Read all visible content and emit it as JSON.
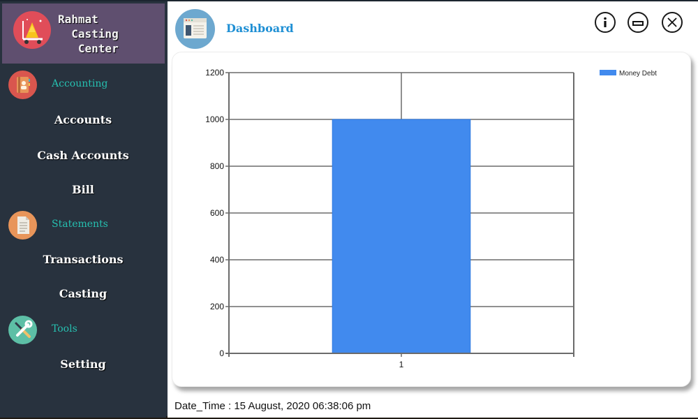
{
  "app": {
    "brand_name": "Rahmat\n  Casting\n   Center",
    "brand_logo_icon": "gold-cart-icon"
  },
  "sidebar": {
    "sections": [
      {
        "label": "Accounting",
        "icon": "address-book-icon",
        "icon_color": "#d9564e",
        "items": [
          "Accounts",
          "Cash Accounts",
          "Bill"
        ]
      },
      {
        "label": "Statements",
        "icon": "document-icon",
        "icon_color": "#e8955a",
        "items": [
          "Transactions",
          "Casting"
        ]
      },
      {
        "label": "Tools",
        "icon": "tools-icon",
        "icon_color": "#5dbfa6",
        "items": [
          "Setting"
        ]
      }
    ]
  },
  "header": {
    "title": "Dashboard",
    "page_icon": "browser-window-icon",
    "buttons": [
      {
        "name": "info",
        "icon": "info-icon"
      },
      {
        "name": "minimize",
        "icon": "minimize-icon"
      },
      {
        "name": "close",
        "icon": "close-icon"
      }
    ]
  },
  "status_bar": {
    "label": "Date_Time :",
    "value": "15 August, 2020 06:38:06 pm"
  },
  "colors": {
    "sidebar_bg": "#28323e",
    "brand_bg": "#5f4f6f",
    "section_label": "#26c0b0",
    "title": "#1e8fd4",
    "bar": "#418aee"
  },
  "chart_data": {
    "type": "bar",
    "title": "",
    "xlabel": "",
    "ylabel": "",
    "categories": [
      "1"
    ],
    "series": [
      {
        "name": "Money Debt",
        "values": [
          1000
        ],
        "color": "#418aee"
      }
    ],
    "ylim": [
      0,
      1200
    ],
    "yticks": [
      0,
      200,
      400,
      600,
      800,
      1000,
      1200
    ],
    "grid": true,
    "legend": "top-right"
  }
}
